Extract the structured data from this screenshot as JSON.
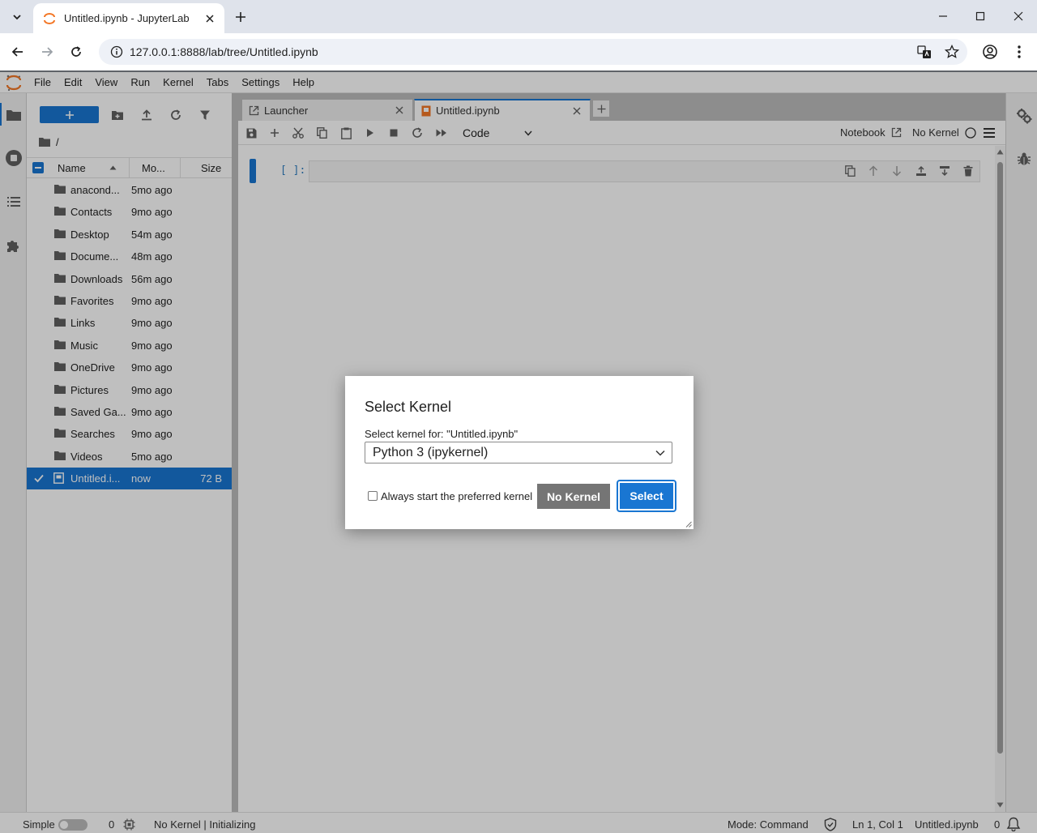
{
  "browser": {
    "tab_title": "Untitled.ipynb - JupyterLab",
    "url": "127.0.0.1:8888/lab/tree/Untitled.ipynb"
  },
  "menu": [
    "File",
    "Edit",
    "View",
    "Run",
    "Kernel",
    "Tabs",
    "Settings",
    "Help"
  ],
  "file_browser": {
    "breadcrumb": "/",
    "columns": {
      "name": "Name",
      "modified": "Mo...",
      "size": "Size"
    },
    "items": [
      {
        "name": "anacond...",
        "modified": "5mo ago",
        "size": "",
        "type": "folder"
      },
      {
        "name": "Contacts",
        "modified": "9mo ago",
        "size": "",
        "type": "folder"
      },
      {
        "name": "Desktop",
        "modified": "54m ago",
        "size": "",
        "type": "folder"
      },
      {
        "name": "Docume...",
        "modified": "48m ago",
        "size": "",
        "type": "folder"
      },
      {
        "name": "Downloads",
        "modified": "56m ago",
        "size": "",
        "type": "folder"
      },
      {
        "name": "Favorites",
        "modified": "9mo ago",
        "size": "",
        "type": "folder"
      },
      {
        "name": "Links",
        "modified": "9mo ago",
        "size": "",
        "type": "folder"
      },
      {
        "name": "Music",
        "modified": "9mo ago",
        "size": "",
        "type": "folder"
      },
      {
        "name": "OneDrive",
        "modified": "9mo ago",
        "size": "",
        "type": "folder"
      },
      {
        "name": "Pictures",
        "modified": "9mo ago",
        "size": "",
        "type": "folder"
      },
      {
        "name": "Saved Ga...",
        "modified": "9mo ago",
        "size": "",
        "type": "folder"
      },
      {
        "name": "Searches",
        "modified": "9mo ago",
        "size": "",
        "type": "folder"
      },
      {
        "name": "Videos",
        "modified": "5mo ago",
        "size": "",
        "type": "folder"
      },
      {
        "name": "Untitled.i...",
        "modified": "now",
        "size": "72 B",
        "type": "notebook",
        "selected": true
      }
    ]
  },
  "doc_tabs": [
    {
      "label": "Launcher",
      "active": false
    },
    {
      "label": "Untitled.ipynb",
      "active": true
    }
  ],
  "notebook_toolbar": {
    "cell_type": "Code",
    "notebook_label": "Notebook",
    "kernel_label": "No Kernel"
  },
  "cell": {
    "prompt": "[ ]:"
  },
  "statusbar": {
    "mode_label": "Simple",
    "terminals_count": "0",
    "kernel_status": "No Kernel | Initializing",
    "mode": "Mode: Command",
    "cursor": "Ln 1, Col 1",
    "file": "Untitled.ipynb",
    "notifications": "0"
  },
  "dialog": {
    "title": "Select Kernel",
    "label": "Select kernel for: \"Untitled.ipynb\"",
    "selected_kernel": "Python 3 (ipykernel)",
    "checkbox_label": "Always start the preferred kernel",
    "no_kernel_button": "No Kernel",
    "select_button": "Select"
  },
  "colors": {
    "accent": "#1976d2",
    "jupyter_orange": "#f37726"
  }
}
